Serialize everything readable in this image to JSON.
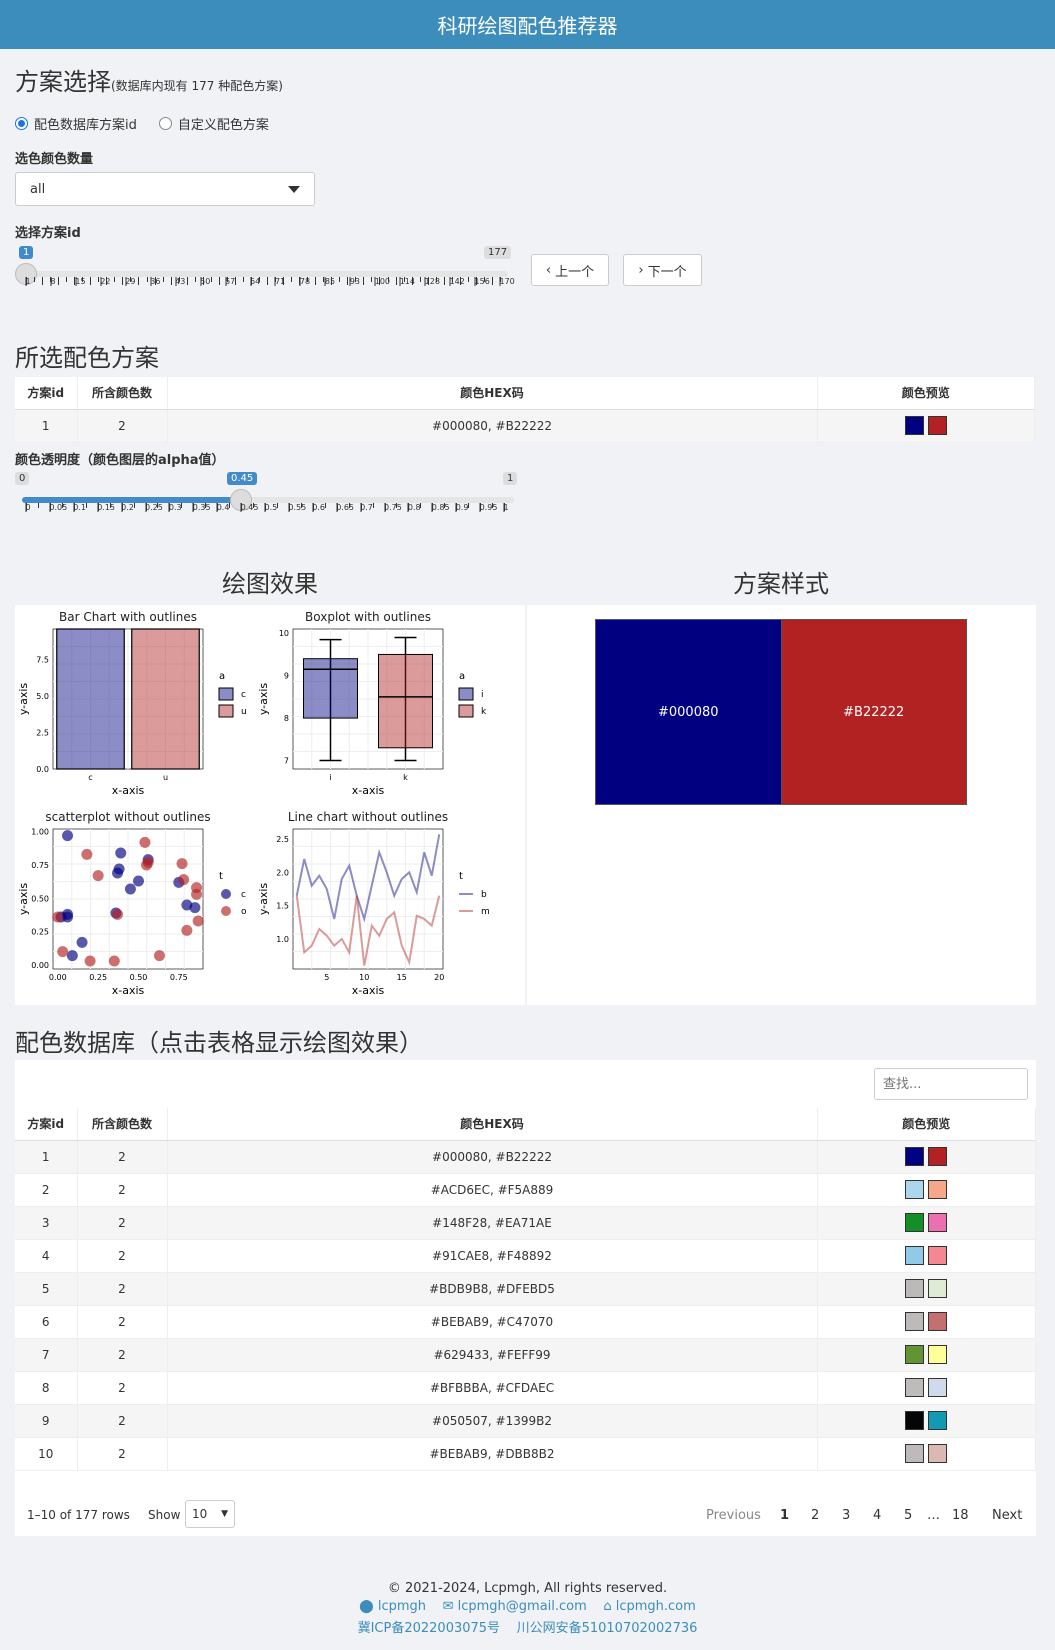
{
  "header": {
    "title": "科研绘图配色推荐器"
  },
  "selection": {
    "title": "方案选择",
    "subtitle": "(数据库内现有 177 种配色方案)",
    "radio_db": "配色数据库方案id",
    "radio_custom": "自定义配色方案",
    "count_label": "选色颜色数量",
    "count_value": "all",
    "id_label": "选择方案id",
    "id_value": "1",
    "id_max": "177",
    "id_ticks": [
      "1",
      "8",
      "15",
      "22",
      "29",
      "36",
      "43",
      "50",
      "57",
      "64",
      "71",
      "78",
      "85",
      "93",
      "100",
      "114",
      "128",
      "142",
      "156",
      "170"
    ],
    "prev_label": "上一个",
    "next_label": "下一个"
  },
  "selected": {
    "title": "所选配色方案",
    "headers": [
      "方案id",
      "所含颜色数",
      "颜色HEX码",
      "颜色预览"
    ],
    "row": {
      "id": "1",
      "count": "2",
      "hex": "#000080, #B22222",
      "colors": [
        "#000080",
        "#B22222"
      ]
    }
  },
  "alpha": {
    "label": "颜色透明度（颜色图层的alpha值）",
    "min": "0",
    "max": "1",
    "value": "0.45",
    "ticks": [
      "0",
      "0.05",
      "0.1",
      "0.15",
      "0.2",
      "0.25",
      "0.3",
      "0.35",
      "0.4",
      "0.45",
      "0.5",
      "0.55",
      "0.6",
      "0.65",
      "0.7",
      "0.75",
      "0.8",
      "0.85",
      "0.9",
      "0.95",
      "1"
    ]
  },
  "plots": {
    "title": "绘图效果",
    "bar": {
      "title": "Bar Chart with outlines",
      "xlabel": "x-axis",
      "ylabel": "y-axis",
      "legend_title": "a",
      "legend": [
        "c",
        "u"
      ],
      "yticks": [
        "0.0",
        "2.5",
        "5.0",
        "7.5"
      ],
      "xticks": [
        "c",
        "u"
      ]
    },
    "box": {
      "title": "Boxplot with outlines",
      "xlabel": "x-axis",
      "ylabel": "y-axis",
      "legend_title": "a",
      "legend": [
        "i",
        "k"
      ],
      "yticks": [
        "7",
        "8",
        "9",
        "10"
      ],
      "xticks": [
        "i",
        "k"
      ]
    },
    "scatter": {
      "title": "scatterplot without outlines",
      "xlabel": "x-axis",
      "ylabel": "y-axis",
      "legend_title": "t",
      "legend": [
        "c",
        "o"
      ],
      "yticks": [
        "0.00",
        "0.25",
        "0.50",
        "0.75",
        "1.00"
      ],
      "xticks": [
        "0.00",
        "0.25",
        "0.50",
        "0.75"
      ]
    },
    "line": {
      "title": "Line chart without outlines",
      "xlabel": "x-axis",
      "ylabel": "y-axis",
      "legend_title": "t",
      "legend": [
        "b",
        "m"
      ],
      "yticks": [
        "1.0",
        "1.5",
        "2.0",
        "2.5"
      ],
      "xticks": [
        "5",
        "10",
        "15",
        "20"
      ]
    }
  },
  "chart_data": [
    {
      "type": "bar",
      "title": "Bar Chart with outlines",
      "categories": [
        "c",
        "u"
      ],
      "values": [
        9.6,
        9.6
      ],
      "ylim": [
        0,
        9.6
      ],
      "colors": [
        "#000080",
        "#B22222"
      ]
    },
    {
      "type": "box",
      "title": "Boxplot with outlines",
      "categories": [
        "i",
        "k"
      ],
      "boxes": [
        {
          "min": 7.0,
          "q1": 8.0,
          "median": 9.15,
          "q3": 9.4,
          "max": 9.85
        },
        {
          "min": 7.0,
          "q1": 7.3,
          "median": 8.5,
          "q3": 9.5,
          "max": 9.9
        }
      ],
      "ylim": [
        6.8,
        10.1
      ]
    },
    {
      "type": "scatter",
      "title": "scatterplot without outlines",
      "xlim": [
        -0.03,
        0.9
      ],
      "ylim": [
        -0.03,
        1.02
      ],
      "series": [
        {
          "name": "c",
          "points": [
            [
              0.06,
              0.97
            ],
            [
              0.02,
              0.36
            ],
            [
              0.06,
              0.38
            ],
            [
              0.06,
              0.36
            ],
            [
              0.09,
              0.07
            ],
            [
              0.15,
              0.17
            ],
            [
              0.36,
              0.39
            ],
            [
              0.38,
              0.72
            ],
            [
              0.37,
              0.69
            ],
            [
              0.39,
              0.84
            ],
            [
              0.45,
              0.57
            ],
            [
              0.5,
              0.63
            ],
            [
              0.56,
              0.79
            ],
            [
              0.75,
              0.62
            ],
            [
              0.8,
              0.45
            ],
            [
              0.85,
              0.43
            ]
          ]
        },
        {
          "name": "o",
          "points": [
            [
              0.0,
              0.36
            ],
            [
              0.03,
              0.1
            ],
            [
              0.18,
              0.83
            ],
            [
              0.25,
              0.67
            ],
            [
              0.37,
              0.38
            ],
            [
              0.35,
              0.03
            ],
            [
              0.2,
              0.03
            ],
            [
              0.55,
              0.75
            ],
            [
              0.56,
              0.77
            ],
            [
              0.54,
              0.92
            ],
            [
              0.63,
              0.07
            ],
            [
              0.77,
              0.76
            ],
            [
              0.78,
              0.64
            ],
            [
              0.8,
              0.26
            ],
            [
              0.86,
              0.58
            ],
            [
              0.86,
              0.53
            ],
            [
              0.87,
              0.33
            ]
          ]
        }
      ]
    },
    {
      "type": "line",
      "title": "Line chart without outlines",
      "xlim": [
        0.5,
        20.5
      ],
      "ylim": [
        0.55,
        2.65
      ],
      "series": [
        {
          "name": "b",
          "values": [
            1.65,
            2.2,
            1.8,
            1.95,
            1.75,
            1.3,
            1.9,
            2.1,
            1.65,
            1.3,
            1.8,
            2.3,
            2.0,
            1.65,
            1.9,
            2.0,
            1.7,
            2.3,
            1.95,
            2.57
          ]
        },
        {
          "name": "m",
          "values": [
            1.65,
            0.8,
            0.9,
            1.15,
            1.05,
            0.9,
            1.0,
            0.8,
            1.65,
            0.6,
            1.2,
            1.05,
            1.3,
            1.4,
            0.9,
            0.65,
            1.35,
            1.3,
            1.2,
            1.65
          ]
        }
      ]
    }
  ],
  "style": {
    "title": "方案样式",
    "blocks": [
      {
        "hex": "#000080"
      },
      {
        "hex": "#B22222"
      }
    ]
  },
  "database": {
    "title": "配色数据库（点击表格显示绘图效果）",
    "search_placeholder": "查找...",
    "headers": [
      "方案id",
      "所含颜色数",
      "颜色HEX码",
      "颜色预览"
    ],
    "rows": [
      {
        "id": "1",
        "count": "2",
        "hex": "#000080, #B22222",
        "colors": [
          "#000080",
          "#B22222"
        ]
      },
      {
        "id": "2",
        "count": "2",
        "hex": "#ACD6EC, #F5A889",
        "colors": [
          "#ACD6EC",
          "#F5A889"
        ]
      },
      {
        "id": "3",
        "count": "2",
        "hex": "#148F28, #EA71AE",
        "colors": [
          "#148F28",
          "#EA71AE"
        ]
      },
      {
        "id": "4",
        "count": "2",
        "hex": "#91CAE8, #F48892",
        "colors": [
          "#91CAE8",
          "#F48892"
        ]
      },
      {
        "id": "5",
        "count": "2",
        "hex": "#BDB9B8, #DFEBD5",
        "colors": [
          "#BDB9B8",
          "#DFEBD5"
        ]
      },
      {
        "id": "6",
        "count": "2",
        "hex": "#BEBAB9, #C47070",
        "colors": [
          "#BEBAB9",
          "#C47070"
        ]
      },
      {
        "id": "7",
        "count": "2",
        "hex": "#629433, #FEFF99",
        "colors": [
          "#629433",
          "#FEFF99"
        ]
      },
      {
        "id": "8",
        "count": "2",
        "hex": "#BFBBBA, #CFDAEC",
        "colors": [
          "#BFBBBA",
          "#CFDAEC"
        ]
      },
      {
        "id": "9",
        "count": "2",
        "hex": "#050507, #1399B2",
        "colors": [
          "#050507",
          "#1399B2"
        ]
      },
      {
        "id": "10",
        "count": "2",
        "hex": "#BEBAB9, #DBB8B2",
        "colors": [
          "#BEBAB9",
          "#DBB8B2"
        ]
      }
    ],
    "info": "1–10 of 177 rows",
    "show_label": "Show",
    "page_size": "10",
    "pager": {
      "previous": "Previous",
      "pages": [
        "1",
        "2",
        "3",
        "4",
        "5"
      ],
      "ellipsis": "…",
      "last": "18",
      "next": "Next"
    }
  },
  "footer": {
    "copyright": "© 2021-2024, Lcpmgh, All rights reserved.",
    "github": "lcpmgh",
    "email": "lcpmgh@gmail.com",
    "site": "lcpmgh.com",
    "icp": "冀ICP备2022003075号",
    "police": "川公网安备51010702002736"
  }
}
